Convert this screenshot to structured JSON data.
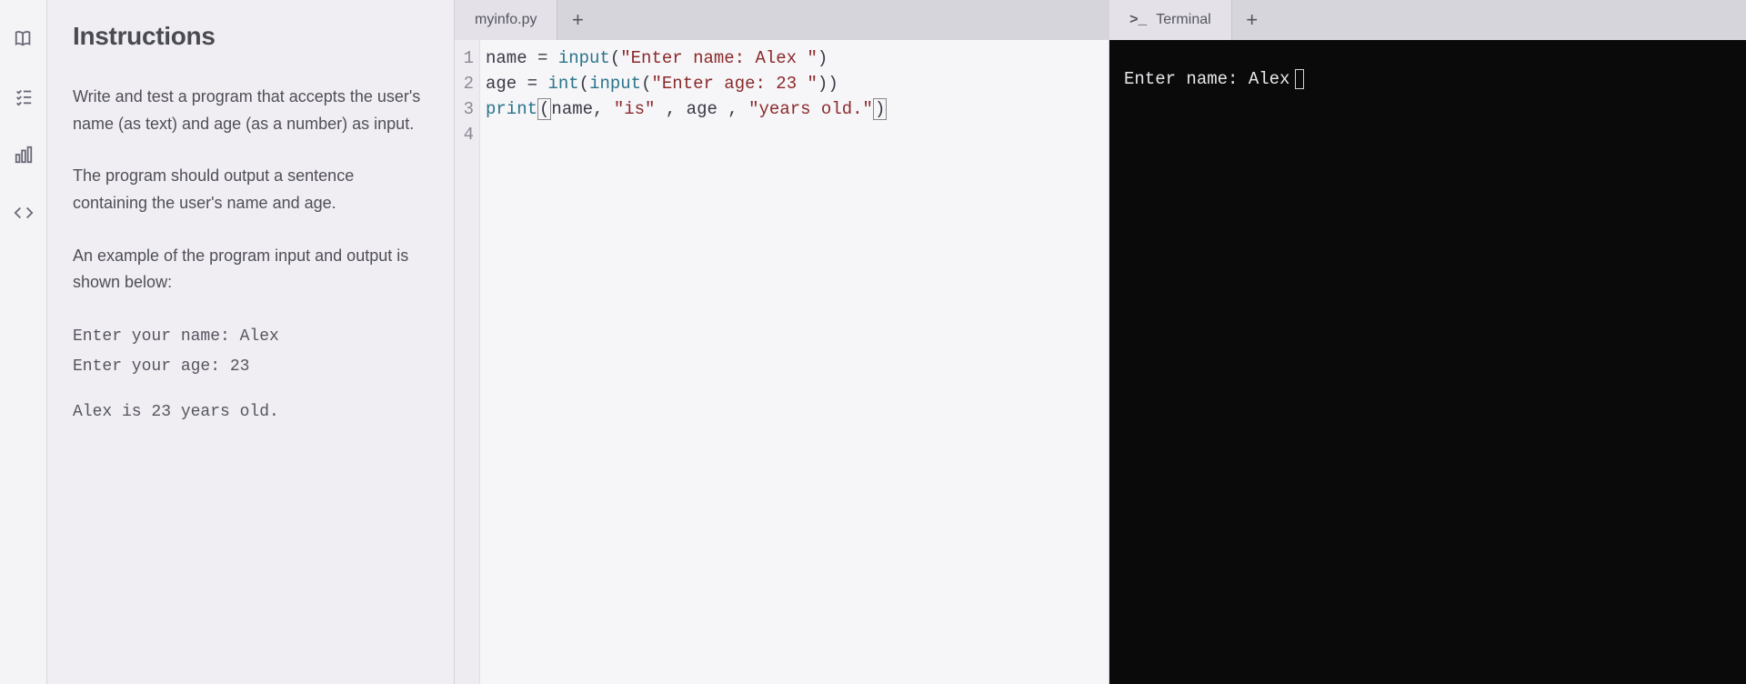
{
  "rail": {
    "icons": [
      "book-icon",
      "checklist-icon",
      "bar-chart-icon",
      "code-icon"
    ]
  },
  "instructions": {
    "title": "Instructions",
    "para1": "Write and test a program that accepts the user's name (as text) and age (as a number) as input.",
    "para2": "The program should output a sentence containing the user's name and age.",
    "para3": "An example of the program input and output is shown below:",
    "example_line1": "Enter your name: Alex",
    "example_line2": "Enter your age: 23",
    "example_line3": "Alex is 23 years old."
  },
  "editor": {
    "tab_label": "myinfo.py",
    "add_tab": "+",
    "gutter": [
      "1",
      "2",
      "3",
      "4"
    ],
    "code": {
      "l1": {
        "var": "name",
        "op": " = ",
        "fn": "input",
        "open": "(",
        "str": "\"Enter name: Alex \"",
        "close": ")"
      },
      "l2": {
        "var": "age",
        "op": " = ",
        "fn": "int",
        "open": "(",
        "fn2": "input",
        "open2": "(",
        "str": "\"Enter age: 23 \"",
        "close2": ")",
        "close": ")"
      },
      "l3": {
        "fn": "print",
        "open": "(",
        "v1": "name",
        "c1": ", ",
        "s1": "\"is\"",
        "c2": " , ",
        "v2": "age",
        "c3": " , ",
        "s2": "\"years old.\"",
        "close": ")"
      }
    }
  },
  "terminal": {
    "prompt_icon": ">_",
    "tab_label": "Terminal",
    "add_tab": "+",
    "line1": "Enter name: Alex"
  }
}
